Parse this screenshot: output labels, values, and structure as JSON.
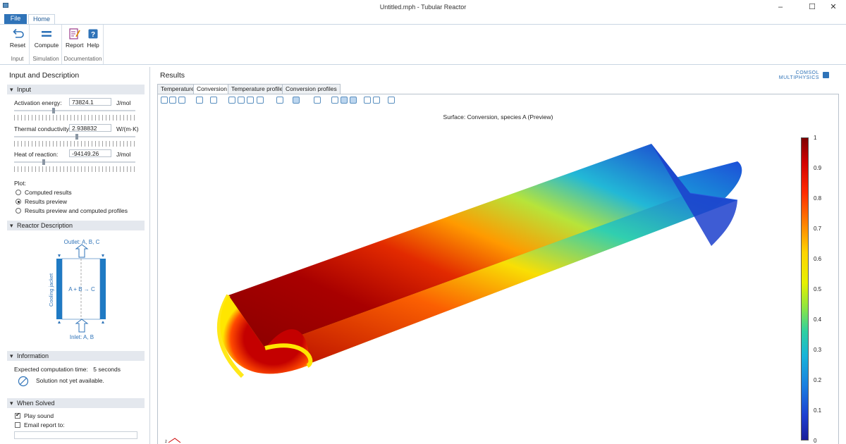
{
  "window": {
    "title": "Untitled.mph - Tubular Reactor",
    "minimize": "–",
    "maximize": "☐",
    "close": "✕"
  },
  "ribbon_tabs": {
    "file": "File",
    "home": "Home"
  },
  "ribbon": {
    "groups": {
      "input": "Input",
      "simulation": "Simulation",
      "documentation": "Documentation"
    },
    "buttons": {
      "reset": "Reset",
      "compute": "Compute",
      "report": "Report",
      "help": "Help"
    }
  },
  "left_panel": {
    "title": "Input and Description",
    "input_section": {
      "header": "Input",
      "activation_energy": {
        "label": "Activation energy:",
        "value": "73824.1",
        "unit": "J/mol",
        "slider_fraction": 0.32
      },
      "thermal_conductivity": {
        "label": "Thermal conductivity:",
        "value": "2.938832",
        "unit": "W/(m·K)",
        "slider_fraction": 0.52
      },
      "heat_of_reaction": {
        "label": "Heat of reaction:",
        "value": "-94149.26",
        "unit": "J/mol",
        "slider_fraction": 0.24
      },
      "plot_label": "Plot:",
      "plot_options": [
        {
          "label": "Computed results",
          "selected": false
        },
        {
          "label": "Results preview",
          "selected": true
        },
        {
          "label": "Results preview and computed profiles",
          "selected": false
        }
      ]
    },
    "reactor_section": {
      "header": "Reactor Description",
      "outlet": "Outlet: A, B, C",
      "reaction": "A + B → C",
      "jacket": "Cooling jacket",
      "inlet": "Inlet: A, B"
    },
    "info_section": {
      "header": "Information",
      "expected_time_label": "Expected computation time:",
      "expected_time_value": "5 seconds",
      "status": "Solution not yet available."
    },
    "solved_section": {
      "header": "When Solved",
      "play_sound": {
        "label": "Play sound",
        "checked": true
      },
      "email_report": {
        "label": "Email report to:",
        "checked": false
      }
    }
  },
  "results": {
    "title": "Results",
    "logo_line1": "COMSOL",
    "logo_line2": "MULTIPHYSICS",
    "tabs": [
      "Temperature",
      "Conversion",
      "Temperature profiles",
      "Conversion profiles"
    ],
    "active_tab": 1,
    "plot_title": "Surface: Conversion, species A (Preview)",
    "colorbar": {
      "labels": [
        "1",
        "0.9",
        "0.8",
        "0.7",
        "0.6",
        "0.5",
        "0.4",
        "0.3",
        "0.2",
        "0.1",
        "0"
      ],
      "max": 1,
      "min": 0
    }
  }
}
